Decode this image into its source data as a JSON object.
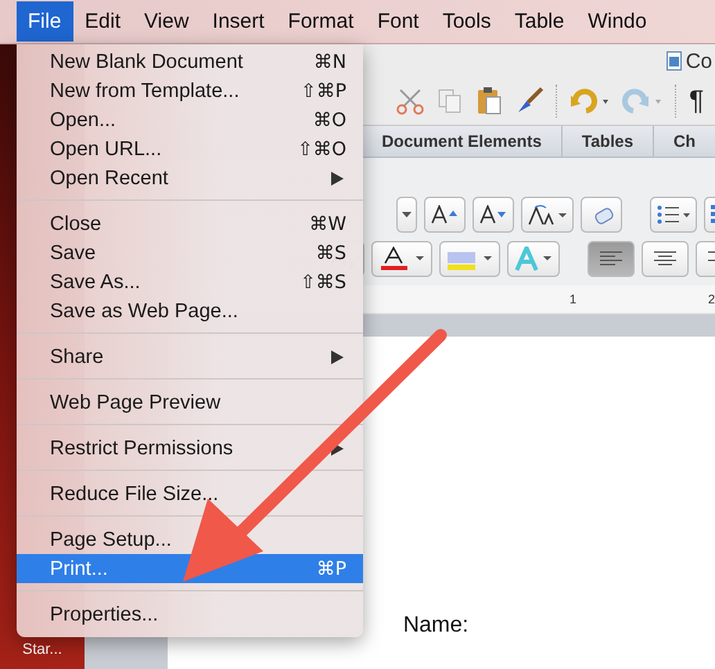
{
  "menu_bar": {
    "items": [
      {
        "label": "File",
        "selected": true
      },
      {
        "label": "Edit",
        "selected": false
      },
      {
        "label": "View",
        "selected": false
      },
      {
        "label": "Insert",
        "selected": false
      },
      {
        "label": "Format",
        "selected": false
      },
      {
        "label": "Font",
        "selected": false
      },
      {
        "label": "Tools",
        "selected": false
      },
      {
        "label": "Table",
        "selected": false
      },
      {
        "label": "Windo",
        "selected": false
      }
    ]
  },
  "desktop": {
    "label": "Star..."
  },
  "document_window": {
    "title": "Co",
    "pilcrow": "¶",
    "ribbon_tabs": [
      "Document Elements",
      "Tables",
      "Ch"
    ],
    "alignment": [
      {
        "selected": true
      },
      {
        "selected": false
      },
      {
        "selected": false
      }
    ],
    "ruler_numbers": [
      "1",
      "2"
    ],
    "document_text": "Name:"
  },
  "file_menu": {
    "groups": [
      [
        {
          "label": "New Blank Document",
          "shortcut": "⌘N",
          "submenu": false,
          "selected": false
        },
        {
          "label": "New from Template...",
          "shortcut": "⇧⌘P",
          "submenu": false,
          "selected": false
        },
        {
          "label": "Open...",
          "shortcut": "⌘O",
          "submenu": false,
          "selected": false
        },
        {
          "label": "Open URL...",
          "shortcut": "⇧⌘O",
          "submenu": false,
          "selected": false
        },
        {
          "label": "Open Recent",
          "submenu": true,
          "selected": false
        }
      ],
      [
        {
          "label": "Close",
          "shortcut": "⌘W",
          "submenu": false,
          "selected": false
        },
        {
          "label": "Save",
          "shortcut": "⌘S",
          "submenu": false,
          "selected": false
        },
        {
          "label": "Save As...",
          "shortcut": "⇧⌘S",
          "submenu": false,
          "selected": false
        },
        {
          "label": "Save as Web Page...",
          "submenu": false,
          "selected": false
        }
      ],
      [
        {
          "label": "Share",
          "submenu": true,
          "selected": false
        }
      ],
      [
        {
          "label": "Web Page Preview",
          "submenu": false,
          "selected": false
        }
      ],
      [
        {
          "label": "Restrict Permissions",
          "submenu": true,
          "selected": false
        }
      ],
      [
        {
          "label": "Reduce File Size...",
          "submenu": false,
          "selected": false
        }
      ],
      [
        {
          "label": "Page Setup...",
          "submenu": false,
          "selected": false
        },
        {
          "label": "Print...",
          "shortcut": "⌘P",
          "submenu": false,
          "selected": true
        }
      ],
      [
        {
          "label": "Properties...",
          "submenu": false,
          "selected": false
        }
      ]
    ]
  }
}
